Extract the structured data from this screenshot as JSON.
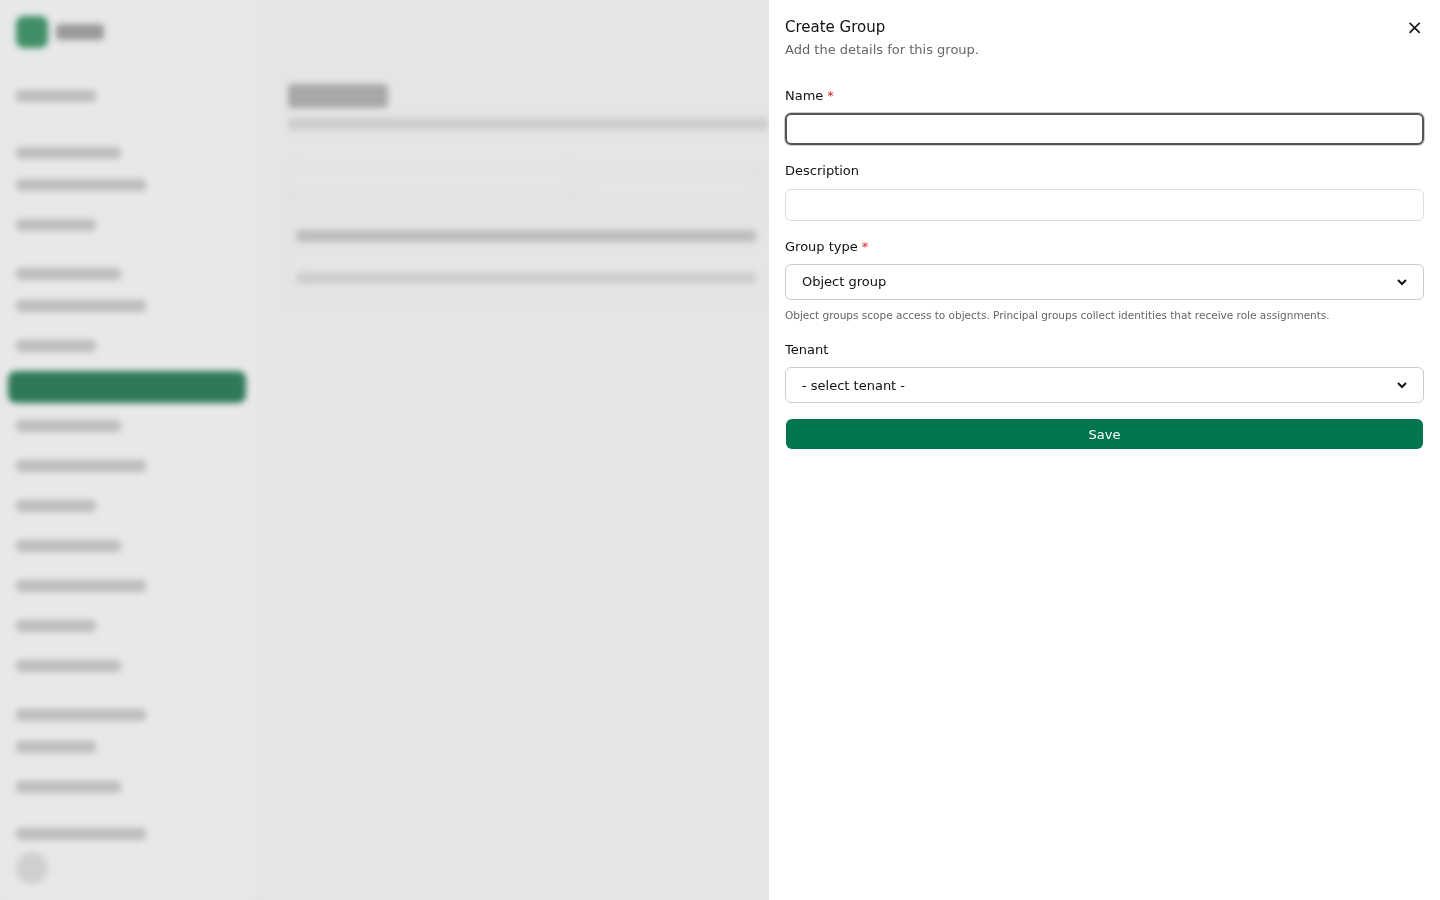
{
  "dialog": {
    "title": "Create Group",
    "subtitle": "Add the details for this group.",
    "close": "×",
    "fields": [
      {
        "kind": "text",
        "label": "Name",
        "required": true,
        "focused": true
      },
      {
        "kind": "text",
        "label": "Description",
        "required": false,
        "focused": false
      },
      {
        "kind": "select",
        "label": "Group type",
        "required": true,
        "value": "Object group",
        "help": "Object groups scope access to objects. Principal groups collect identities that receive role assignments."
      },
      {
        "kind": "select",
        "label": "Tenant",
        "required": false,
        "value": "- select tenant -"
      }
    ],
    "required_mark": "*",
    "submit": "Save"
  }
}
